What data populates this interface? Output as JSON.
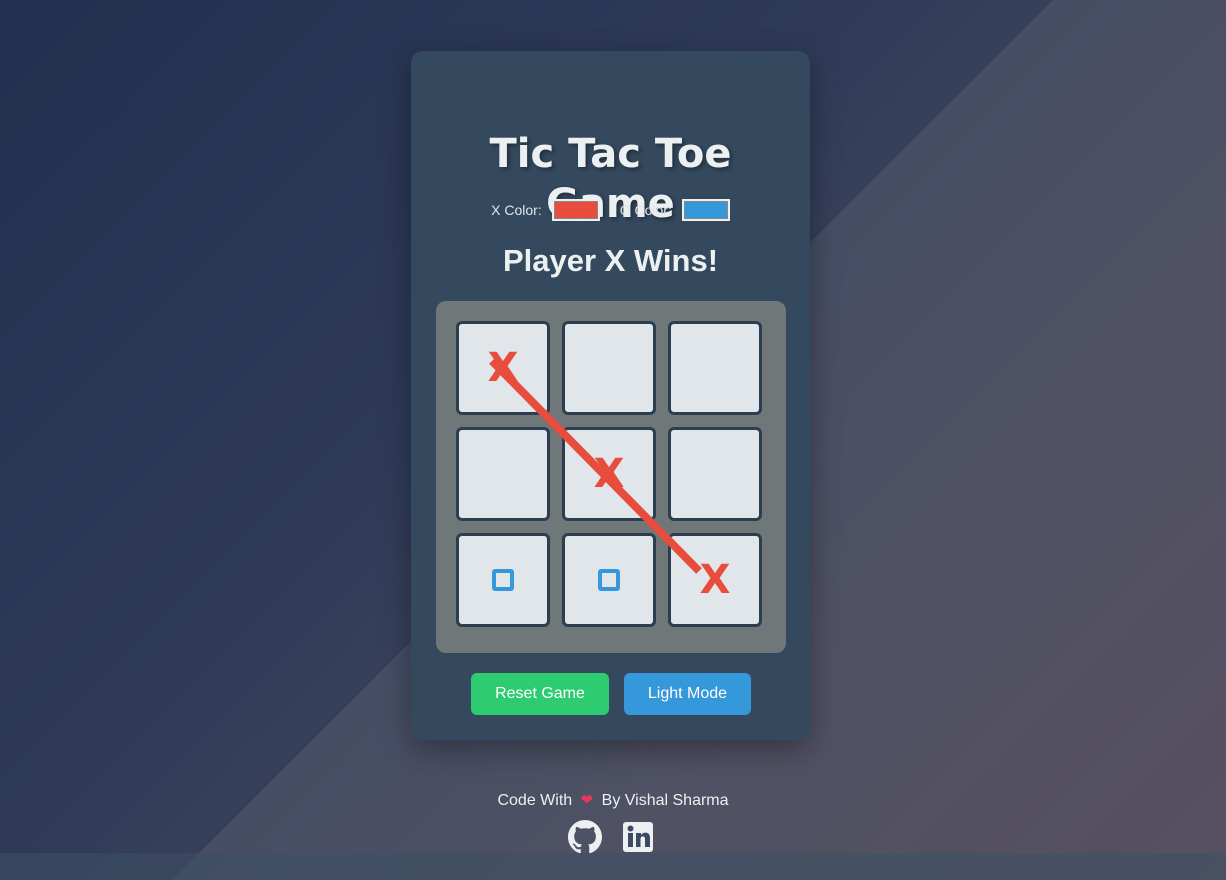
{
  "game": {
    "title_line1": "Tic Tac Toe",
    "title_line2": "Game",
    "x_color_label": "X Color:",
    "o_color_label": "O Color:",
    "x_color": "#e74c3c",
    "o_color": "#3498db",
    "status": "Player X Wins!",
    "board": [
      "X",
      "",
      "",
      "",
      "X",
      "",
      "O",
      "O",
      "X"
    ],
    "winning_line": [
      0,
      4,
      8
    ]
  },
  "buttons": {
    "reset": "Reset Game",
    "mode": "Light Mode"
  },
  "footer": {
    "prefix": "Code With",
    "heart_icon": "heart-icon",
    "suffix": "By Vishal Sharma",
    "links": [
      "github-icon",
      "linkedin-icon"
    ]
  }
}
